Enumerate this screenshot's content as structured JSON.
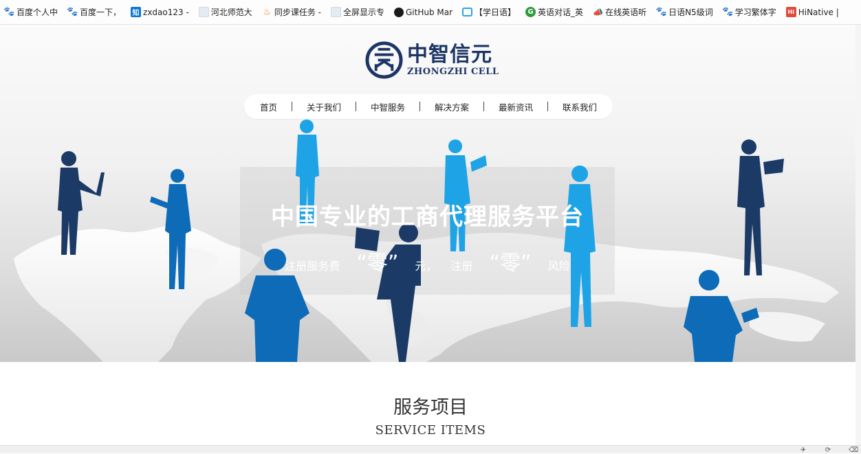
{
  "bookmarks": [
    {
      "icon": "baidu-paw-icon",
      "label": "百度个人中"
    },
    {
      "icon": "baidu-paw-icon",
      "label": "百度一下，"
    },
    {
      "icon": "zhihu-icon",
      "label": "zxdao123 -"
    },
    {
      "icon": "blank-page-icon",
      "label": "河北师范大"
    },
    {
      "icon": "fire-icon",
      "label": "同步课任务 -"
    },
    {
      "icon": "blank-page-icon",
      "label": "全屏显示专"
    },
    {
      "icon": "github-icon",
      "label": "GitHub Mar"
    },
    {
      "icon": "bilibili-icon",
      "label": "【学日语】"
    },
    {
      "icon": "green-g-icon",
      "label": "英语对话_英"
    },
    {
      "icon": "horn-icon",
      "label": "在线英语听"
    },
    {
      "icon": "baidu-paw-icon",
      "label": "日语N5级词"
    },
    {
      "icon": "baidu-paw-icon",
      "label": "学习繁体字"
    },
    {
      "icon": "hinative-icon",
      "label": "HiNative |"
    }
  ],
  "logo": {
    "cn": "中智信元",
    "en": "ZHONGZHI CELL"
  },
  "nav": {
    "items": [
      "首页",
      "关于我们",
      "中智服务",
      "解决方案",
      "最新资讯",
      "联系我们"
    ]
  },
  "banner": {
    "title": "中国专业的工商代理服务平台",
    "sub_1": "注册服务费",
    "sub_2": "“零”",
    "sub_3": "元，",
    "sub_4": "注册",
    "sub_5": "“零”",
    "sub_6": "风险"
  },
  "service": {
    "title": "服务项目",
    "subtitle": "SERVICE ITEMS"
  },
  "colors": {
    "brand_navy": "#1d3566",
    "silhouette_dark": "#1b3a66",
    "silhouette_mid": "#0d6bb8",
    "silhouette_light": "#1ea3e6"
  }
}
